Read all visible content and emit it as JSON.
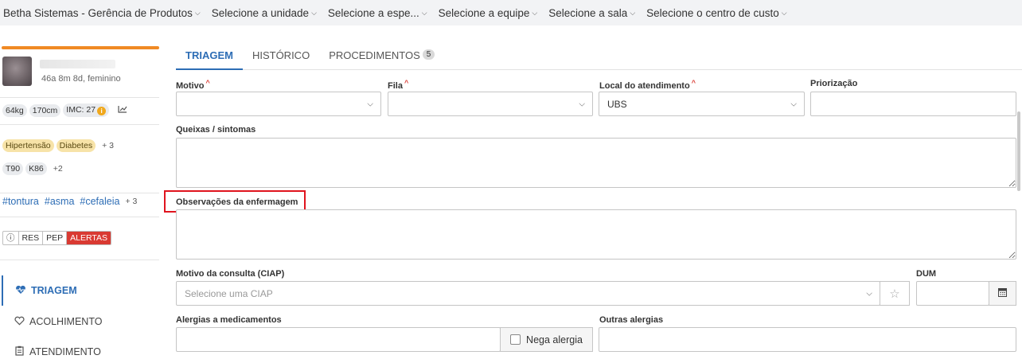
{
  "topnav": {
    "items": [
      {
        "label": "Betha Sistemas - Gerência de Produtos"
      },
      {
        "label": "Selecione a unidade"
      },
      {
        "label": "Selecione a espe..."
      },
      {
        "label": "Selecione a equipe"
      },
      {
        "label": "Selecione a sala"
      },
      {
        "label": "Selecione o centro de custo"
      }
    ]
  },
  "patient": {
    "info": "46a 8m 8d, feminino",
    "weight": "64kg",
    "height": "170cm",
    "imc": "IMC: 27",
    "conditions": [
      "Hipertensão",
      "Diabetes"
    ],
    "conditions_more": "+ 3",
    "codes": [
      "T90",
      "K86"
    ],
    "codes_more": "+2",
    "hashtags": [
      "#tontura",
      "#asma",
      "#cefaleia"
    ],
    "hashtags_more": "+ 3",
    "segments": [
      "ⓘ",
      "RES",
      "PEP",
      "ALERTAS"
    ]
  },
  "menu": [
    {
      "label": "TRIAGEM",
      "icon": "heart-pulse-icon"
    },
    {
      "label": "ACOLHIMENTO",
      "icon": "heart-outline-icon"
    },
    {
      "label": "ATENDIMENTO",
      "icon": "clipboard-icon"
    }
  ],
  "tabs": [
    {
      "label": "TRIAGEM"
    },
    {
      "label": "HISTÓRICO"
    },
    {
      "label": "PROCEDIMENTOS",
      "badge": "5"
    }
  ],
  "form": {
    "motivo_label": "Motivo",
    "fila_label": "Fila",
    "local_label": "Local do atendimento",
    "local_value": "UBS",
    "priorizacao_label": "Priorização",
    "queixas_label": "Queixas / sintomas",
    "observacoes_label": "Observações da enfermagem",
    "motivo_consulta_label": "Motivo da consulta (CIAP)",
    "ciap_placeholder": "Selecione uma CIAP",
    "dum_label": "DUM",
    "alergias_label": "Alergias a medicamentos",
    "nega_alergia_label": "Nega alergia",
    "outras_alergias_label": "Outras alergias"
  },
  "colors": {
    "accent": "#2d6db5",
    "orange": "#f08a24",
    "alert": "#d93a32",
    "highlight": "#e0141e"
  }
}
